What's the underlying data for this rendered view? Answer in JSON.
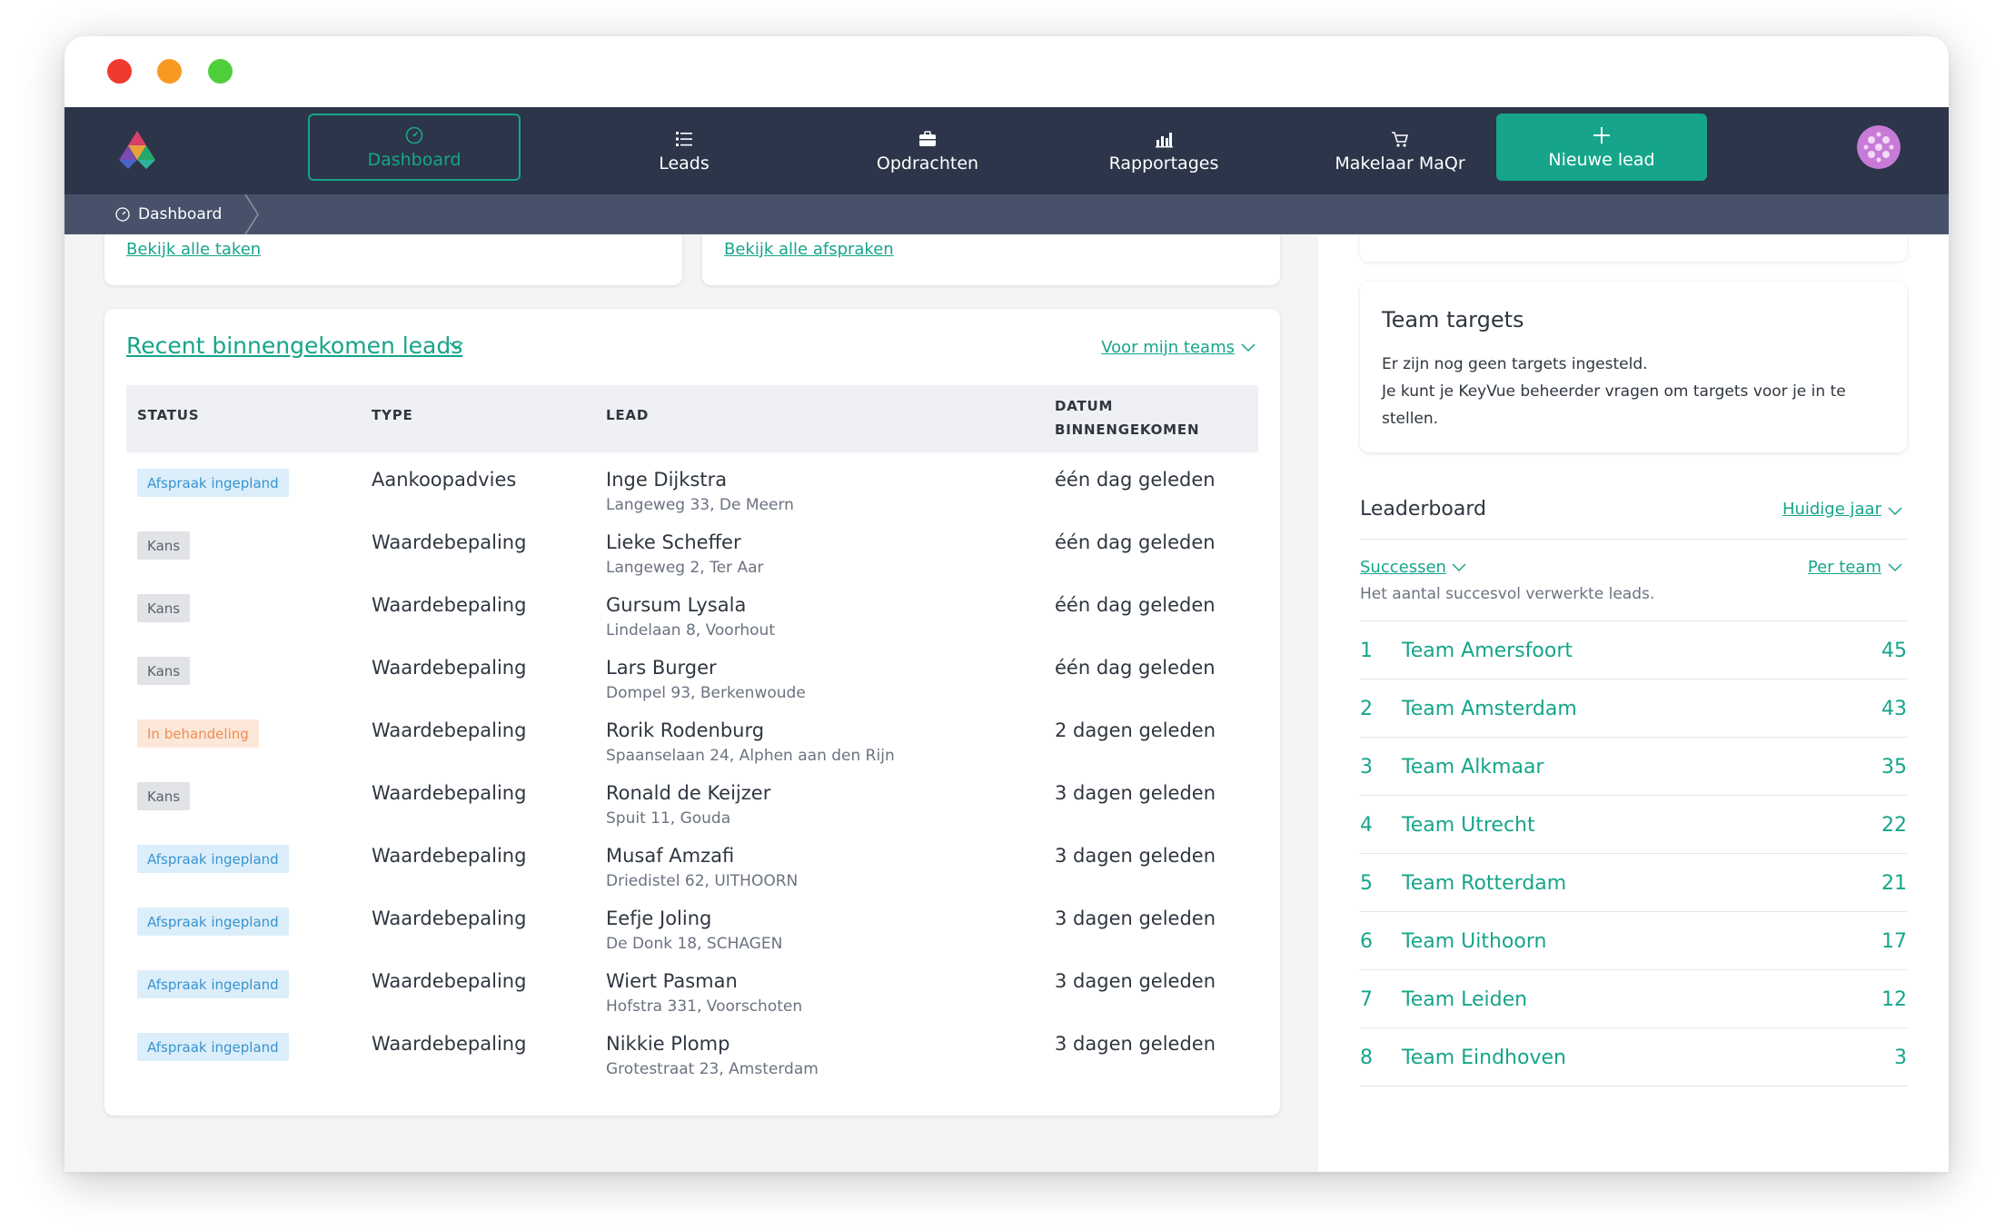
{
  "nav": {
    "items": [
      {
        "label": "Dashboard",
        "icon": "dashboard-gauge-icon"
      },
      {
        "label": "Leads",
        "icon": "list-icon"
      },
      {
        "label": "Opdrachten",
        "icon": "briefcase-icon"
      },
      {
        "label": "Rapportages",
        "icon": "bar-chart-icon"
      },
      {
        "label": "Makelaar MaQr",
        "icon": "cart-icon"
      }
    ],
    "new_lead_label": "Nieuwe lead",
    "accent": "#16a58a",
    "background": "#2c3549"
  },
  "breadcrumb": {
    "label": "Dashboard"
  },
  "tasks_link": "Bekijk alle taken",
  "appointments_link": "Bekijk alle afspraken",
  "leads": {
    "title": "Recent binnengekomen leads",
    "filter": "Voor mijn teams",
    "columns": {
      "status": "STATUS",
      "type": "TYPE",
      "lead": "LEAD",
      "date_line1": "DATUM",
      "date_line2": "BINNENGEKOMEN"
    },
    "rows": [
      {
        "status": "Afspraak ingepland",
        "status_kind": "afspraak",
        "type": "Aankoopadvies",
        "name": "Inge Dijkstra",
        "address": "Langeweg 33, De Meern",
        "date": "één dag geleden"
      },
      {
        "status": "Kans",
        "status_kind": "kans",
        "type": "Waardebepaling",
        "name": "Lieke Scheffer",
        "address": "Langeweg 2, Ter Aar",
        "date": "één dag geleden"
      },
      {
        "status": "Kans",
        "status_kind": "kans",
        "type": "Waardebepaling",
        "name": "Gursum Lysala",
        "address": "Lindelaan 8, Voorhout",
        "date": "één dag geleden"
      },
      {
        "status": "Kans",
        "status_kind": "kans",
        "type": "Waardebepaling",
        "name": "Lars Burger",
        "address": "Dompel 93, Berkenwoude",
        "date": "één dag geleden"
      },
      {
        "status": "In behandeling",
        "status_kind": "behandeling",
        "type": "Waardebepaling",
        "name": "Rorik Rodenburg",
        "address": "Spaanselaan 24, Alphen aan den Rijn",
        "date": "2 dagen geleden"
      },
      {
        "status": "Kans",
        "status_kind": "kans",
        "type": "Waardebepaling",
        "name": "Ronald de Keijzer",
        "address": "Spuit 11, Gouda",
        "date": "3 dagen geleden"
      },
      {
        "status": "Afspraak ingepland",
        "status_kind": "afspraak",
        "type": "Waardebepaling",
        "name": "Musaf Amzafi",
        "address": "Driedistel 62, UITHOORN",
        "date": "3 dagen geleden"
      },
      {
        "status": "Afspraak ingepland",
        "status_kind": "afspraak",
        "type": "Waardebepaling",
        "name": "Eefje Joling",
        "address": "De Donk 18, SCHAGEN",
        "date": "3 dagen geleden"
      },
      {
        "status": "Afspraak ingepland",
        "status_kind": "afspraak",
        "type": "Waardebepaling",
        "name": "Wiert Pasman",
        "address": "Hofstra 331, Voorschoten",
        "date": "3 dagen geleden"
      },
      {
        "status": "Afspraak ingepland",
        "status_kind": "afspraak",
        "type": "Waardebepaling",
        "name": "Nikkie Plomp",
        "address": "Grotestraat 23, Amsterdam",
        "date": "3 dagen geleden"
      }
    ]
  },
  "targets": {
    "title": "Team targets",
    "line1": "Er zijn nog geen targets ingesteld.",
    "line2": "Je kunt je KeyVue beheerder vragen om targets voor je in te stellen."
  },
  "leaderboard": {
    "title": "Leaderboard",
    "period": "Huidige jaar",
    "metric": "Successen",
    "group": "Per team",
    "description": "Het aantal succesvol verwerkte leads.",
    "teams": [
      {
        "rank": "1",
        "name": "Team Amersfoort",
        "score": "45"
      },
      {
        "rank": "2",
        "name": "Team Amsterdam",
        "score": "43"
      },
      {
        "rank": "3",
        "name": "Team Alkmaar",
        "score": "35"
      },
      {
        "rank": "4",
        "name": "Team Utrecht",
        "score": "22"
      },
      {
        "rank": "5",
        "name": "Team Rotterdam",
        "score": "21"
      },
      {
        "rank": "6",
        "name": "Team Uithoorn",
        "score": "17"
      },
      {
        "rank": "7",
        "name": "Team Leiden",
        "score": "12"
      },
      {
        "rank": "8",
        "name": "Team Eindhoven",
        "score": "3"
      }
    ]
  }
}
